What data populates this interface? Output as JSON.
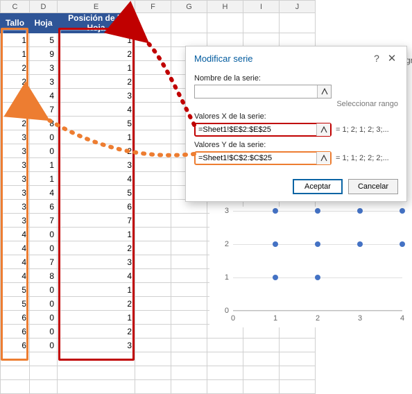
{
  "columns": [
    "C",
    "D",
    "E",
    "F",
    "G",
    "H",
    "I",
    "J"
  ],
  "headers": {
    "tallo": "Tallo",
    "hoja": "Hoja",
    "pos": "Posición de la Hoja"
  },
  "rows": [
    {
      "t": 1,
      "h": 5,
      "p": 1
    },
    {
      "t": 1,
      "h": 9,
      "p": 2
    },
    {
      "t": 2,
      "h": 3,
      "p": 1
    },
    {
      "t": 2,
      "h": 3,
      "p": 2
    },
    {
      "t": 2,
      "h": 4,
      "p": 3
    },
    {
      "t": 2,
      "h": 7,
      "p": 4
    },
    {
      "t": 2,
      "h": 8,
      "p": 5
    },
    {
      "t": 3,
      "h": 0,
      "p": 1
    },
    {
      "t": 3,
      "h": 0,
      "p": 2
    },
    {
      "t": 3,
      "h": 1,
      "p": 3
    },
    {
      "t": 3,
      "h": 1,
      "p": 4
    },
    {
      "t": 3,
      "h": 4,
      "p": 5
    },
    {
      "t": 3,
      "h": 6,
      "p": 6
    },
    {
      "t": 3,
      "h": 7,
      "p": 7
    },
    {
      "t": 4,
      "h": 0,
      "p": 1
    },
    {
      "t": 4,
      "h": 0,
      "p": 2
    },
    {
      "t": 4,
      "h": 7,
      "p": 3
    },
    {
      "t": 4,
      "h": 8,
      "p": 4
    },
    {
      "t": 5,
      "h": 0,
      "p": 1
    },
    {
      "t": 5,
      "h": 0,
      "p": 2
    },
    {
      "t": 6,
      "h": 0,
      "p": 1
    },
    {
      "t": 6,
      "h": 0,
      "p": 2
    },
    {
      "t": 6,
      "h": 0,
      "p": 3
    }
  ],
  "dialog": {
    "title": "Modificar serie",
    "name_label": "Nombre de la serie:",
    "name_value": "",
    "select_range": "Seleccionar rango",
    "x_label": "Valores X de la serie:",
    "x_value": "=Sheet1!$E$2:$E$25",
    "x_preview": "= 1; 2; 1; 2; 3;...",
    "y_label": "Valores Y de la serie:",
    "y_value": "=Sheet1!$C$2:$C$25",
    "y_preview": "= 1; 1; 2; 2; 2;...",
    "ok": "Aceptar",
    "cancel": "Cancelar"
  },
  "chart_data": {
    "type": "scatter",
    "xlabel": "",
    "ylabel": "",
    "xlim": [
      0,
      4
    ],
    "ylim": [
      0,
      3
    ],
    "xticks": [
      0,
      1,
      2,
      3,
      4
    ],
    "yticks": [
      0,
      1,
      2,
      3
    ],
    "points": [
      {
        "x": 1,
        "y": 1
      },
      {
        "x": 2,
        "y": 1
      },
      {
        "x": 1,
        "y": 2
      },
      {
        "x": 2,
        "y": 2
      },
      {
        "x": 3,
        "y": 2
      },
      {
        "x": 4,
        "y": 2
      },
      {
        "x": 1,
        "y": 3
      },
      {
        "x": 2,
        "y": 3
      },
      {
        "x": 3,
        "y": 3
      },
      {
        "x": 4,
        "y": 3
      }
    ]
  },
  "frag": "gr"
}
